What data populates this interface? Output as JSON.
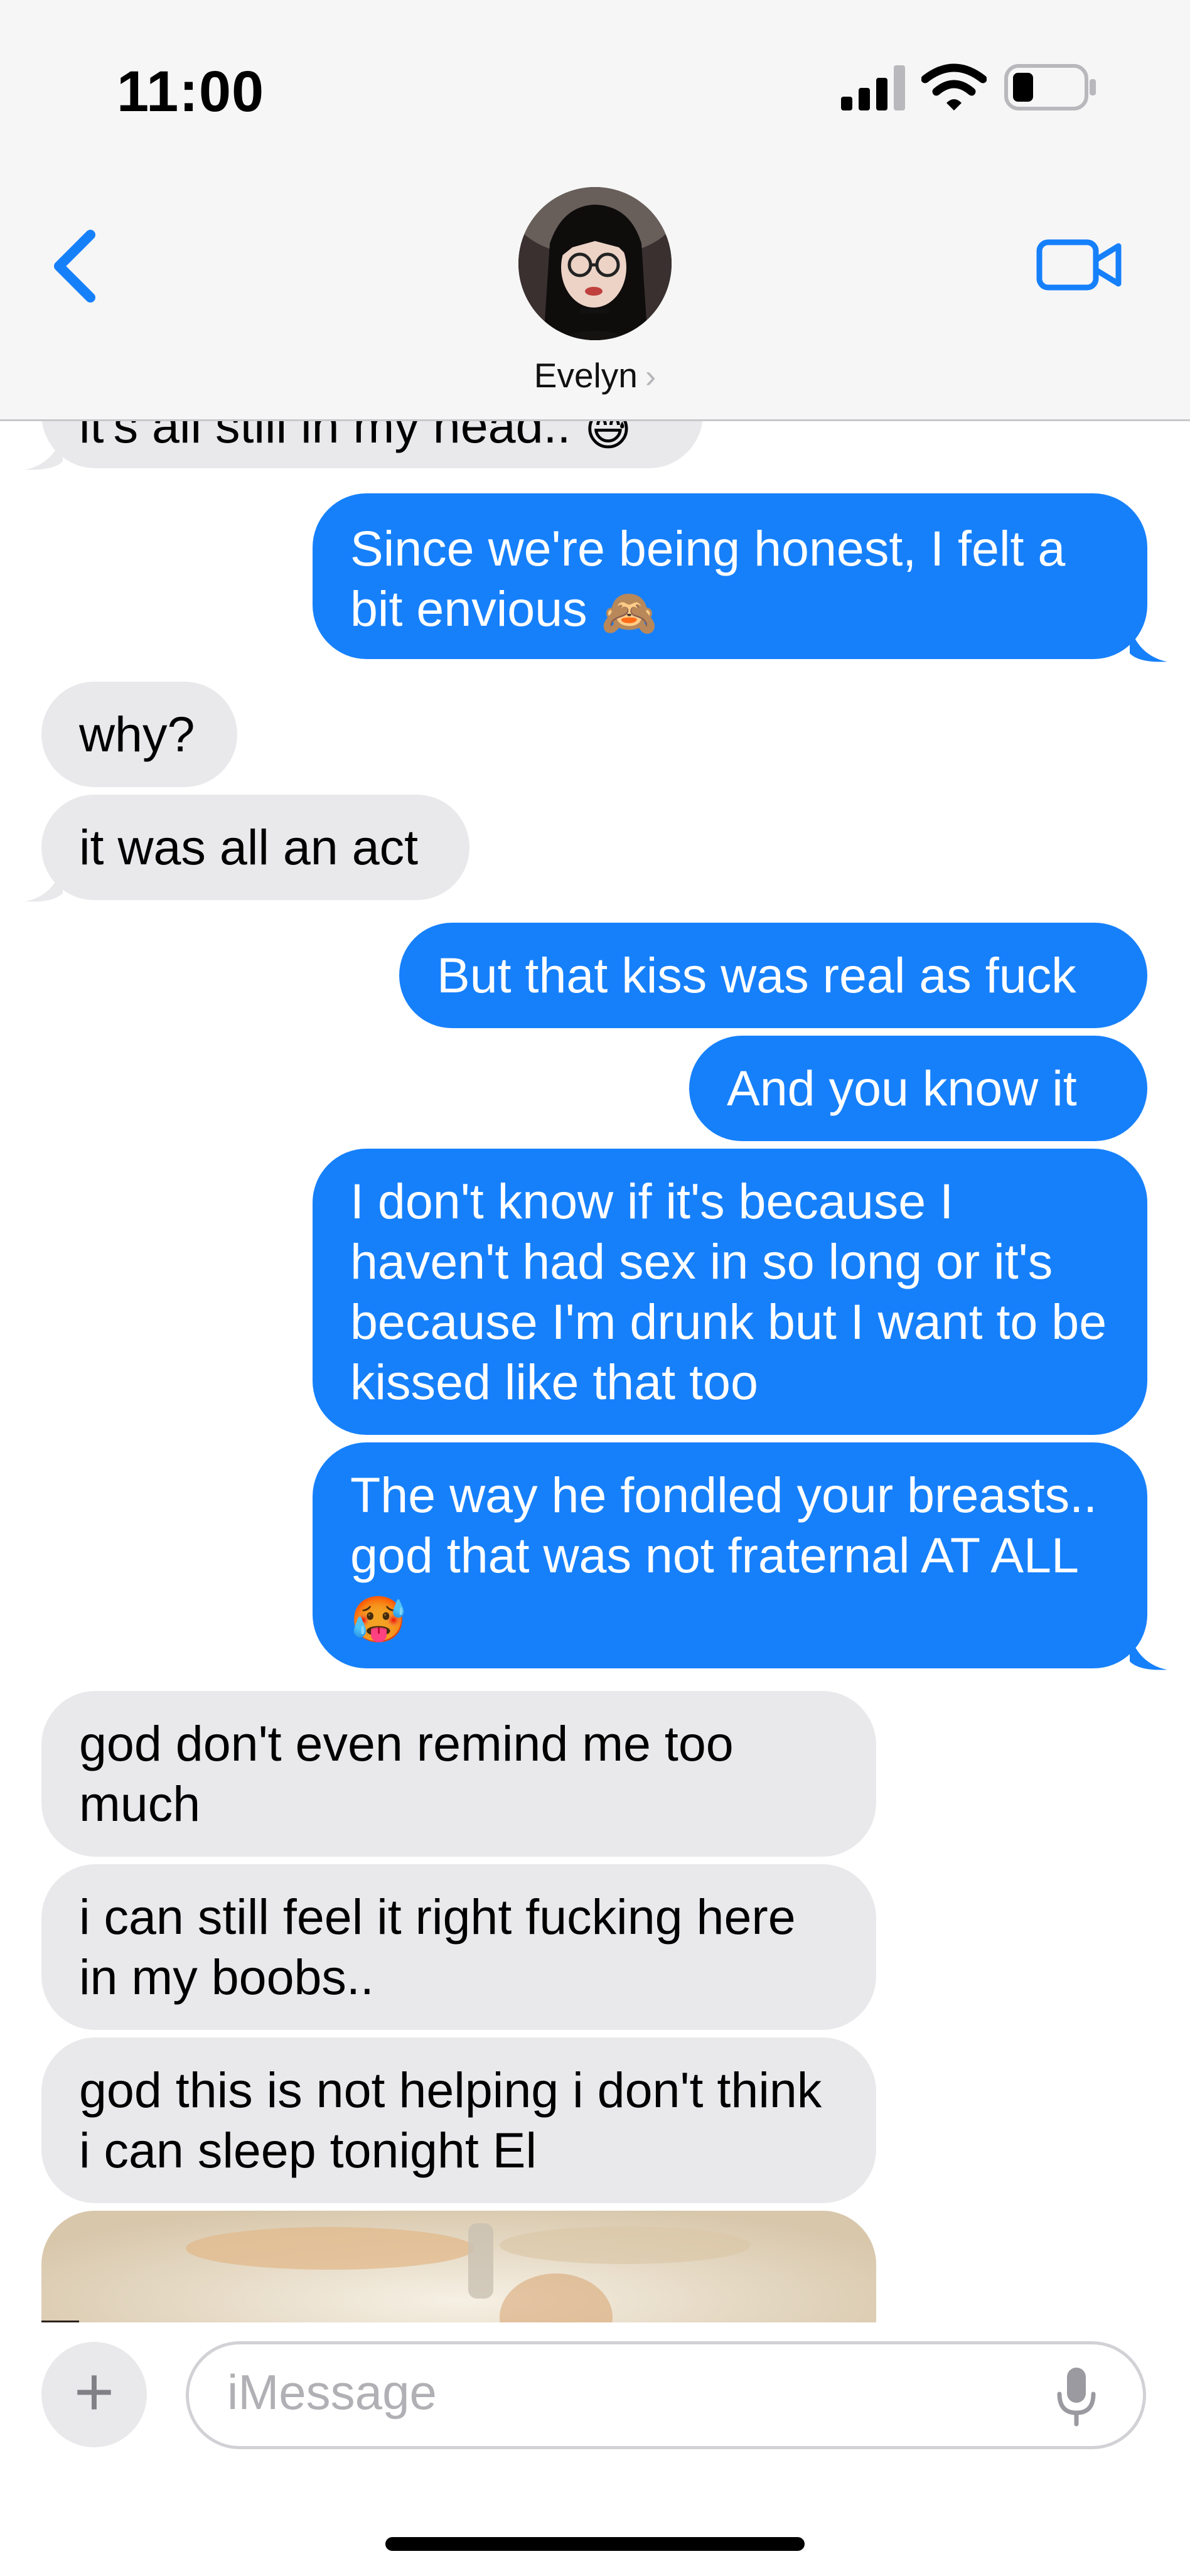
{
  "status_bar": {
    "time": "11:00"
  },
  "header": {
    "contact_name": "Evelyn",
    "contact_chevron": "›"
  },
  "messages": [
    {
      "from": "them",
      "text": "it's all still in my head.. ",
      "emoji": "😅"
    },
    {
      "from": "me",
      "text": "Since we're being honest, I felt a bit envious ",
      "emoji": "🙈"
    },
    {
      "from": "them",
      "text": "why?"
    },
    {
      "from": "them",
      "text": "it was all an act"
    },
    {
      "from": "me",
      "text": "But that kiss was real as fuck"
    },
    {
      "from": "me",
      "text": "And you know it"
    },
    {
      "from": "me",
      "text": "I don't know if it's because I haven't had sex in so long or it's because I'm drunk but I want to be kissed like that too"
    },
    {
      "from": "me",
      "text": "The way he fondled your breasts.. god that was not fraternal AT ALL ",
      "emoji": "🥵"
    },
    {
      "from": "them",
      "text": "god don't even remind me too much"
    },
    {
      "from": "them",
      "text": "i can still feel it right fucking here in my boobs.."
    },
    {
      "from": "them",
      "text": "god this is not helping i don't think i can sleep tonight El"
    }
  ],
  "compose": {
    "plus_label": "+",
    "placeholder": "iMessage"
  },
  "colors": {
    "accent": "#1680fb",
    "incoming_bubble": "#e9e9eb",
    "header_bg": "#f6f6f6"
  },
  "icons": {
    "back": "chevron-left-icon",
    "video": "video-camera-icon",
    "mic": "microphone-icon",
    "signal": "signal-bars-icon",
    "wifi": "wifi-icon",
    "battery": "battery-icon"
  }
}
